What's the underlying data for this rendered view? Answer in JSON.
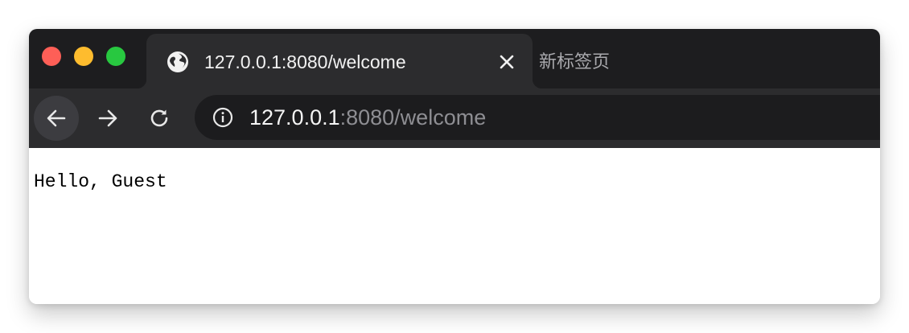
{
  "window": {
    "traffic_lights": {
      "close_color": "#fe5f57",
      "minimize_color": "#febc2e",
      "maximize_color": "#28c840"
    }
  },
  "tabs": {
    "active": {
      "title": "127.0.0.1:8080/welcome",
      "favicon": "globe-icon",
      "close_icon": "close-icon"
    },
    "inactive": {
      "title": "新标签页"
    }
  },
  "toolbar": {
    "back_icon": "arrow-left-icon",
    "forward_icon": "arrow-right-icon",
    "reload_icon": "reload-icon",
    "address": {
      "info_icon": "info-icon",
      "host": "127.0.0.1",
      "rest": ":8080/welcome"
    }
  },
  "page": {
    "body_text": "Hello, Guest"
  },
  "colors": {
    "tabstrip_bg": "#1d1d1f",
    "toolbar_bg": "#2c2c2e",
    "omnibox_bg": "#1c1c1e"
  }
}
